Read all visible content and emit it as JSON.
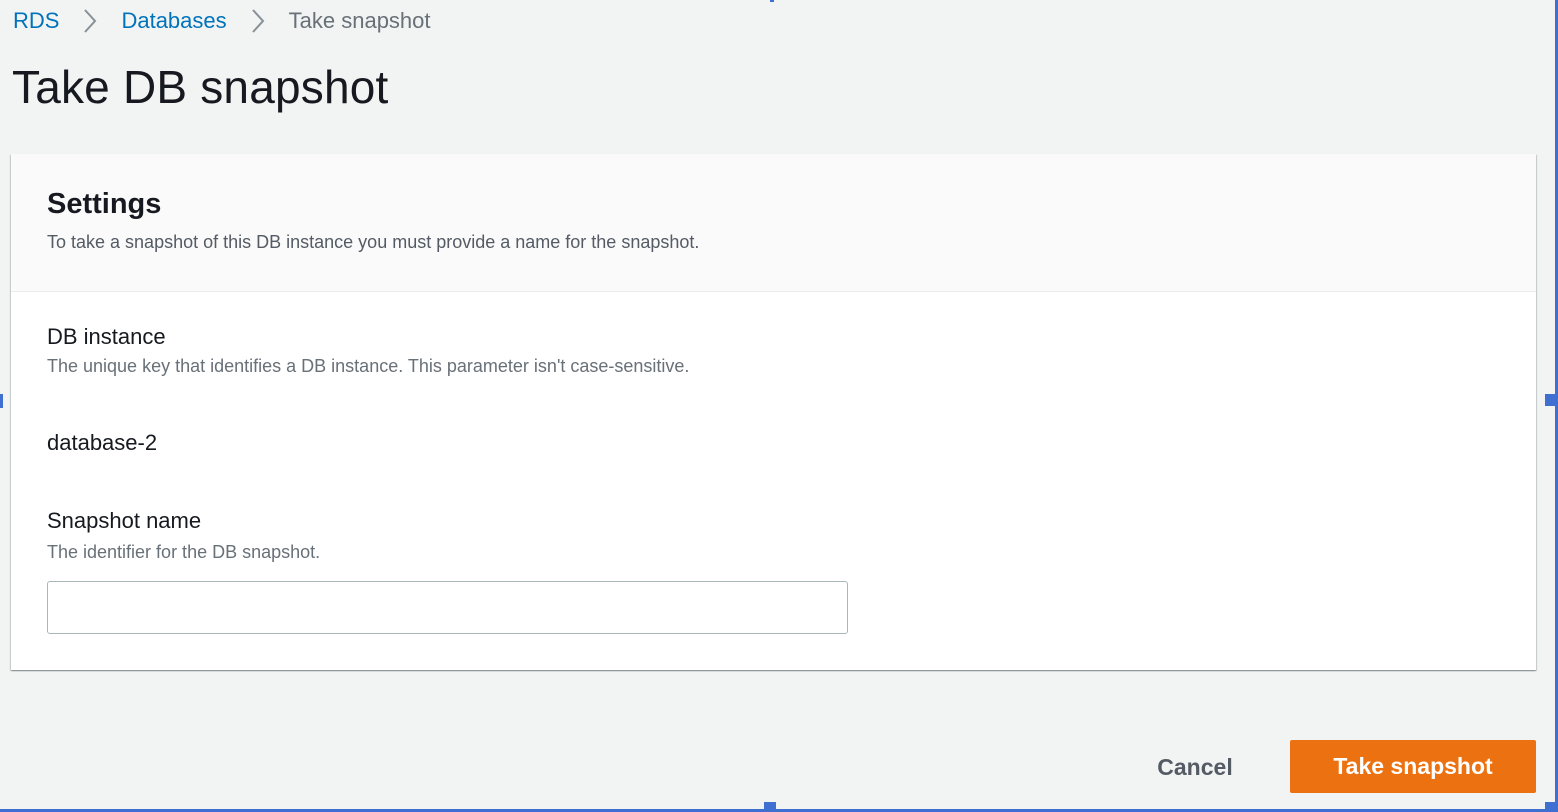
{
  "breadcrumb": {
    "items": [
      {
        "label": "RDS"
      },
      {
        "label": "Databases"
      },
      {
        "label": "Take snapshot"
      }
    ]
  },
  "page": {
    "title": "Take DB snapshot"
  },
  "settings": {
    "title": "Settings",
    "description": "To take a snapshot of this DB instance you must provide a name for the snapshot.",
    "db_instance": {
      "label": "DB instance",
      "description": "The unique key that identifies a DB instance. This parameter isn't case-sensitive.",
      "value": "database-2"
    },
    "snapshot_name": {
      "label": "Snapshot name",
      "description": "The identifier for the DB snapshot.",
      "value": "",
      "placeholder": ""
    }
  },
  "actions": {
    "cancel_label": "Cancel",
    "submit_label": "Take snapshot"
  },
  "colors": {
    "link": "#0073bb",
    "primary": "#ec7211",
    "background": "#f2f3f3",
    "selection_handle": "#3f6fd1"
  },
  "icons": {
    "breadcrumb_separator": "chevron-right-icon"
  }
}
